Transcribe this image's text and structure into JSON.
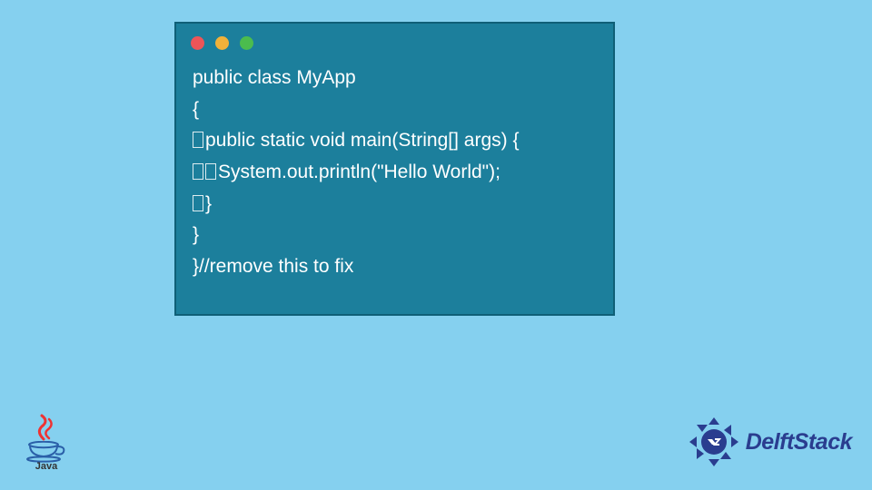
{
  "window": {
    "dots": [
      "red",
      "yellow",
      "green"
    ]
  },
  "code": {
    "l1": "public class MyApp",
    "l2": "{",
    "l3": "public static void main(String[] args) {",
    "l4": "System.out.println(\"Hello World\");",
    "l5": "}",
    "l6": "}",
    "l7": "}//remove this to fix"
  },
  "logos": {
    "java_label": "Java",
    "delft_label": "DelftStack"
  }
}
